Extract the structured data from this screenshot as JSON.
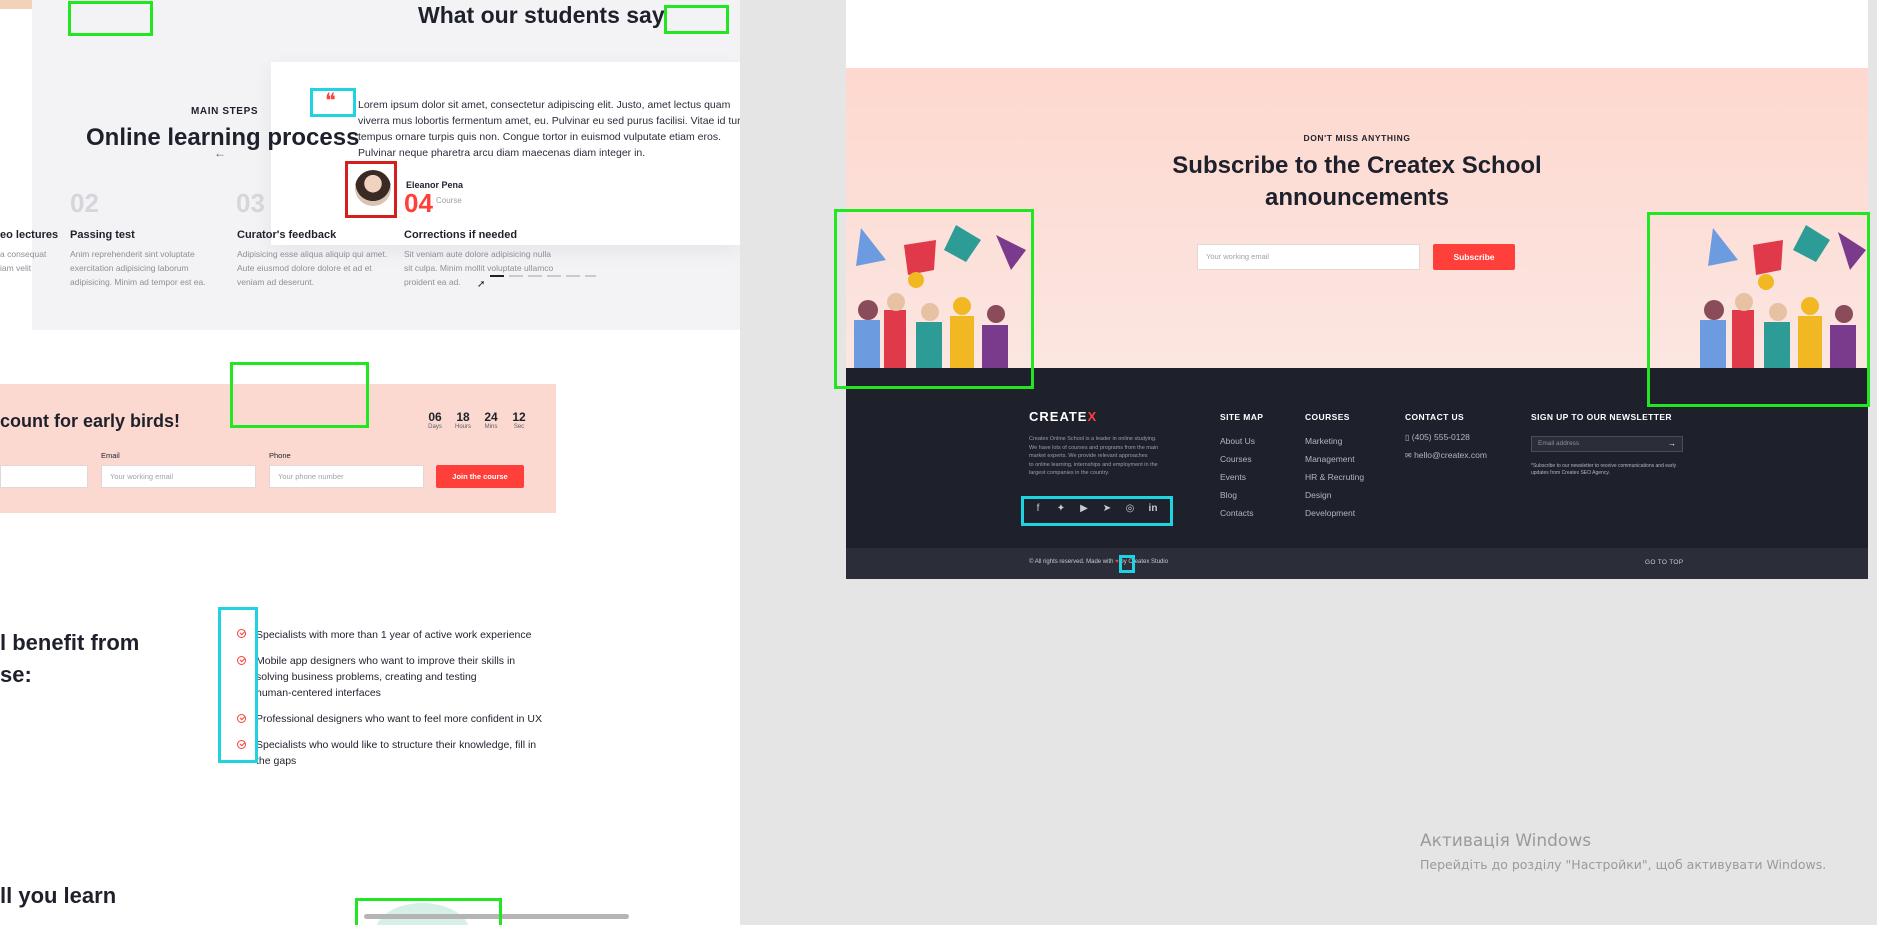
{
  "left": {
    "section_title": "What our students say",
    "steps": {
      "eyebrow": "MAIN STEPS",
      "title": "Online learning process",
      "items": [
        {
          "title": "eo lectures",
          "text": [
            "a consequat",
            "iam velit"
          ]
        },
        {
          "num": "02",
          "title": "Passing test",
          "text": [
            "Anim reprehenderit sint voluptate",
            "exercitation adipisicing laborum",
            "adipisicing. Minim ad tempor est ea."
          ]
        },
        {
          "num": "03",
          "title": "Curator's feedback",
          "text": [
            "Adipisicing esse aliqua aliquip qui amet.",
            "Aute eiusmod dolore dolore et ad et",
            "veniam ad deserunt."
          ]
        },
        {
          "num": "04",
          "title": "Corrections if needed",
          "text": [
            "Sit veniam aute dolore adipisicing nulla",
            "sit culpa. Minim mollit voluptate ullamco",
            "proident ea ad."
          ]
        }
      ]
    },
    "testimonial": {
      "quote_mark": "❝",
      "lines": [
        "Lorem ipsum dolor sit amet, consectetur adipiscing elit. Justo, amet lectus quam",
        "viverra mus lobortis fermentum amet, eu. Pulvinar eu sed purus facilisi. Vitae id turpis",
        "tempus ornare turpis quis non. Congue tortor in euismod vulputate etiam eros.",
        "Pulvinar neque pharetra arcu diam maecenas diam integer in."
      ],
      "author_name": "Eleanor Pena",
      "author_course": "Course"
    },
    "promo": {
      "title": "count for early birds!",
      "countdown": [
        {
          "value": "06",
          "label": "Days"
        },
        {
          "value": "18",
          "label": "Hours"
        },
        {
          "value": "24",
          "label": "Mins"
        },
        {
          "value": "12",
          "label": "Sec"
        }
      ],
      "email_label": "Email",
      "email_placeholder": "Your working email",
      "phone_label": "Phone",
      "phone_placeholder": "Your phone number",
      "join_button": "Join the course"
    },
    "benefit": {
      "title_line1": "l benefit from",
      "title_line2": "se:",
      "items": [
        [
          "Specialists with more than 1 year of active work experience"
        ],
        [
          "Mobile app designers who want to improve their skills in",
          "solving business problems, creating and testing",
          "human-centered interfaces"
        ],
        [
          "Professional designers who want to feel more confident in UX"
        ],
        [
          "Specialists who would like to structure their knowledge, fill in",
          "the gaps"
        ]
      ]
    },
    "learn_title": "ll you learn"
  },
  "right": {
    "subscribe": {
      "eyebrow": "DON'T MISS ANYTHING",
      "title_line1": "Subscribe to the Createx School",
      "title_line2": "announcements",
      "email_placeholder": "Your working email",
      "button": "Subscribe"
    },
    "footer": {
      "logo_text": "CREATE",
      "logo_x": "X",
      "about": [
        "Createx Online School is a leader in online studying.",
        "We have lots of courses and programs from the main",
        "market experts. We provide relevant approaches",
        "to online learning, internships and employment in the",
        "largest companies in the country."
      ],
      "social_icons": [
        "facebook-icon",
        "twitter-icon",
        "youtube-icon",
        "telegram-icon",
        "instagram-icon",
        "linkedin-icon"
      ],
      "sitemap": {
        "title": "SITE MAP",
        "links": [
          "About Us",
          "Courses",
          "Events",
          "Blog",
          "Contacts"
        ]
      },
      "courses": {
        "title": "COURSES",
        "links": [
          "Marketing",
          "Management",
          "HR & Recruting",
          "Design",
          "Development"
        ]
      },
      "contact": {
        "title": "CONTACT US",
        "phone": "(405) 555-0128",
        "email": "hello@createx.com"
      },
      "newsletter": {
        "title": "SIGN UP TO OUR NEWSLETTER",
        "placeholder": "Email address",
        "note_line1": "*Subscribe to our newsletter to receive communications and early",
        "note_line2": "updates from Createx SEO Agency."
      },
      "copyright_a": "© All rights reserved. Made with",
      "copyright_b": "by Createx Studio",
      "go_top": "GO TO TOP"
    }
  },
  "windows": {
    "line1": "Активація Windows",
    "line2": "Перейдіть до розділу \"Настройки\", щоб активувати Windows."
  }
}
